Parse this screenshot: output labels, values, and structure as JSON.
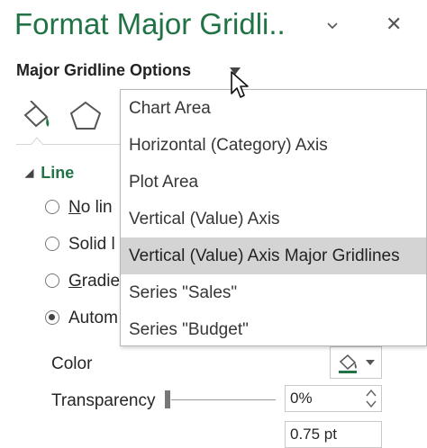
{
  "pane": {
    "title": "Format Major Gridli..",
    "options_label": "Major Gridline Options"
  },
  "tabs": {
    "fill_line_icon": "paint-bucket-icon",
    "effects_icon": "pentagon-icon"
  },
  "section": {
    "label": "Line",
    "radios": [
      {
        "text": "No lin",
        "underline_char": "N",
        "checked": false
      },
      {
        "text": "Solid l",
        "underline_char": "",
        "checked": false
      },
      {
        "text": "Gradie",
        "underline_char": "G",
        "checked": false
      },
      {
        "text": "Autom",
        "underline_char": "",
        "checked": true
      }
    ],
    "color_label": "Color",
    "transparency_label": "Transparency",
    "transparency_value": "0%",
    "width_value": "0.75 pt"
  },
  "dropdown": {
    "items": [
      "Chart Area",
      "Horizontal (Category) Axis",
      "Plot Area",
      "Vertical (Value) Axis",
      "Vertical (Value) Axis Major Gridlines",
      "Series \"Sales\"",
      "Series \"Budget\""
    ],
    "selected_index": 4
  },
  "colors": {
    "accent": "#217346",
    "selected_bg": "#d4d4d4"
  }
}
